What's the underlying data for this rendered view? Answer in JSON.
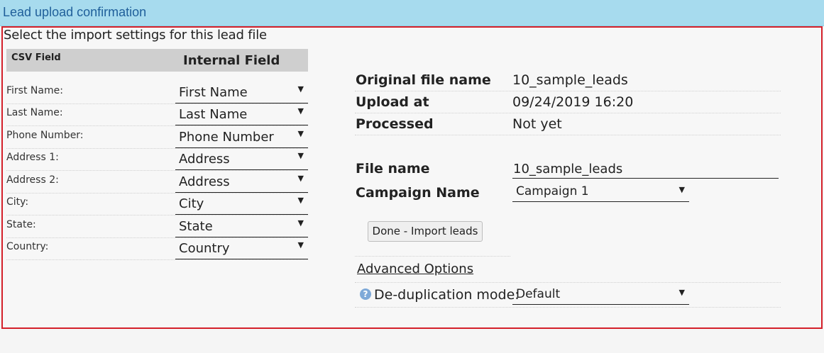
{
  "header": {
    "title": "Lead upload confirmation"
  },
  "instructions": "Select the import settings for this lead file",
  "mapping": {
    "col_csv": "CSV Field",
    "col_internal": "Internal Field",
    "rows": [
      {
        "label": "First Name:",
        "value": "First Name"
      },
      {
        "label": "Last Name:",
        "value": "Last Name"
      },
      {
        "label": "Phone Number:",
        "value": "Phone Number"
      },
      {
        "label": "Address 1:",
        "value": "Address"
      },
      {
        "label": "Address 2:",
        "value": "Address"
      },
      {
        "label": "City:",
        "value": "City"
      },
      {
        "label": "State:",
        "value": "State"
      },
      {
        "label": "Country:",
        "value": "Country"
      }
    ]
  },
  "info": {
    "original_file_label": "Original file name",
    "original_file_value": "10_sample_leads",
    "upload_label": "Upload at",
    "upload_value": "09/24/2019 16:20",
    "processed_label": "Processed",
    "processed_value": "Not yet"
  },
  "form": {
    "file_name_label": "File name",
    "file_name_value": "10_sample_leads",
    "campaign_label": "Campaign Name",
    "campaign_value": "Campaign 1",
    "import_button": "Done - Import leads",
    "advanced_label": "Advanced Options",
    "dedup_label": "De-duplication mode:",
    "dedup_value": "Default"
  },
  "icons": {
    "dropdown": "caret-down-icon",
    "help": "question-circle-icon"
  },
  "colors": {
    "titlebar": "#a7dbee",
    "title_text": "#1f5f9a",
    "panel_border": "#d4202a"
  }
}
